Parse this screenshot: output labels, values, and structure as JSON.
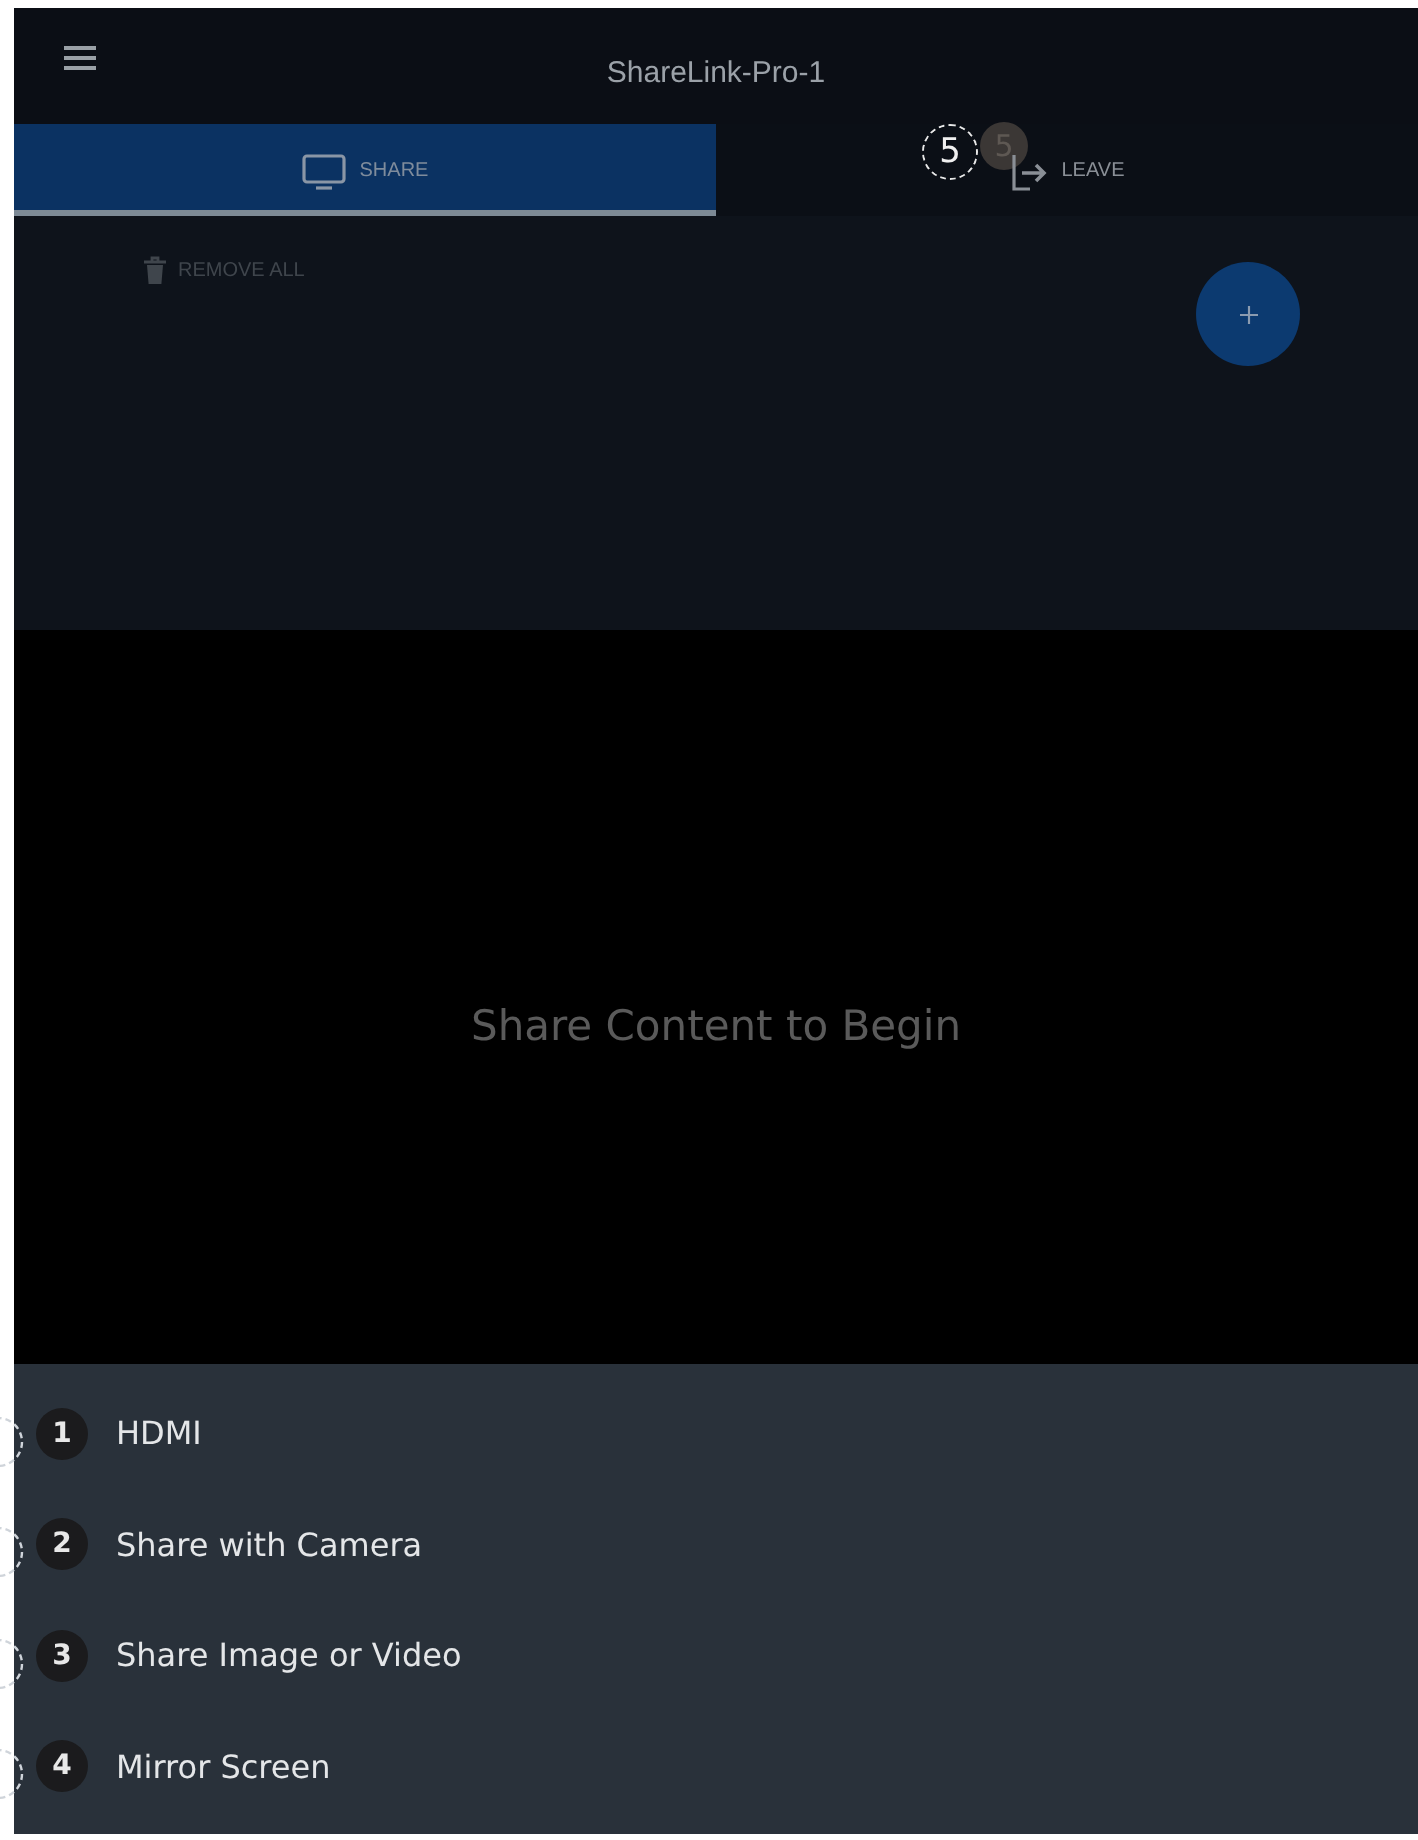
{
  "top_bar": {
    "title": "ShareLink-Pro-1"
  },
  "tabs": [
    {
      "kind": "share",
      "label": "SHARE",
      "selected": true
    },
    {
      "kind": "leave",
      "label": "LEAVE",
      "selected": false
    }
  ],
  "callouts": [
    {
      "kind": "outlined",
      "number": "5"
    },
    {
      "kind": "filled",
      "number": "5"
    }
  ],
  "toolbar": {
    "remove_all": "REMOVE ALL"
  },
  "main": {
    "message": "Share Content to Begin"
  },
  "share_menu": [
    {
      "number": "1",
      "label": "HDMI"
    },
    {
      "number": "2",
      "label": "Share with Camera"
    },
    {
      "number": "3",
      "label": "Share Image or Video"
    },
    {
      "number": "4",
      "label": "Mirror Screen"
    }
  ]
}
